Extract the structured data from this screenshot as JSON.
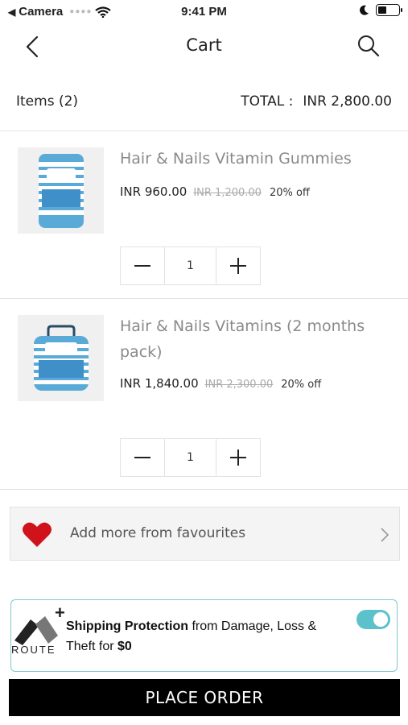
{
  "status_bar": {
    "carrier": "Camera",
    "time": "9:41 PM",
    "battery_level": 0.45
  },
  "nav": {
    "title": "Cart"
  },
  "summary": {
    "items_label": "Items (2)",
    "total_label": "TOTAL :",
    "total_value": "INR 2,800.00"
  },
  "cart_items": [
    {
      "name": "Hair & Nails Vitamin Gummies",
      "price": "INR 960.00",
      "original_price": "INR 1,200.00",
      "discount": "20% off",
      "quantity": "1",
      "image_icon": "vitamin-jar-icon"
    },
    {
      "name": "Hair & Nails Vitamins (2 months pack)",
      "price": "INR 1,840.00",
      "original_price": "INR 2,300.00",
      "discount": "20% off",
      "quantity": "1",
      "image_icon": "vitamin-pack-icon"
    }
  ],
  "favourites": {
    "label": "Add more from favourites"
  },
  "route": {
    "logo_text": "ROUTE",
    "title": "Shipping Protection",
    "text_mid": " from Damage, Loss & Theft for ",
    "price": "$0",
    "toggle_on": true,
    "accent": "#5bc2cc"
  },
  "actions": {
    "place_order": "PLACE ORDER"
  },
  "colors": {
    "heart": "#d0121b",
    "button_bg": "#000000"
  }
}
